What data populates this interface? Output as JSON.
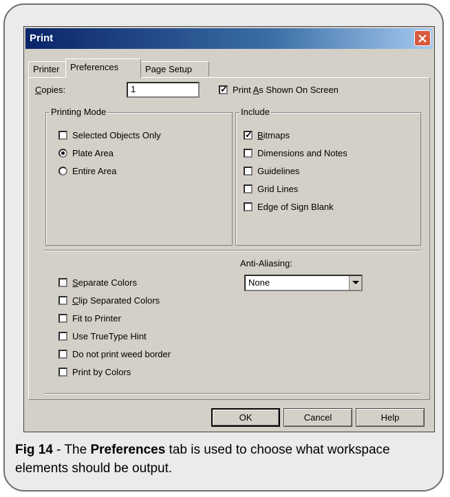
{
  "dialog": {
    "title": "Print"
  },
  "tabs": [
    "Printer",
    "Preferences",
    "Page Setup"
  ],
  "copies": {
    "label_u": "C",
    "label_rest": "opies:",
    "value": "1"
  },
  "print_as_shown": {
    "pre": "Print ",
    "u": "A",
    "post": "s Shown On Screen",
    "checked": true
  },
  "printing_mode": {
    "legend": "Printing Mode",
    "selected_only": "Selected Objects Only",
    "plate_area": "Plate Area",
    "entire_area": "Entire Area"
  },
  "include": {
    "legend": "Include",
    "bitmaps_u": "B",
    "bitmaps_rest": "itmaps",
    "dimensions": "Dimensions and Notes",
    "guidelines": "Guidelines",
    "grid_lines": "Grid Lines",
    "edge_blank": "Edge of Sign Blank"
  },
  "options": {
    "separate_u": "S",
    "separate_rest": "eparate Colors",
    "clip_u": "C",
    "clip_rest": "lip Separated Colors",
    "fit": "Fit to Printer",
    "truetype": "Use TrueType Hint",
    "weed": "Do not print weed border",
    "by_colors": "Print by Colors"
  },
  "anti_aliasing": {
    "label": "Anti-Aliasing:",
    "value": "None"
  },
  "buttons": {
    "ok": "OK",
    "cancel": "Cancel",
    "help": "Help"
  },
  "caption": {
    "fig": "Fig 14",
    "t1": " - The ",
    "bold": "Preferences",
    "t2": " tab is used to choose what workspace elements should be output."
  }
}
